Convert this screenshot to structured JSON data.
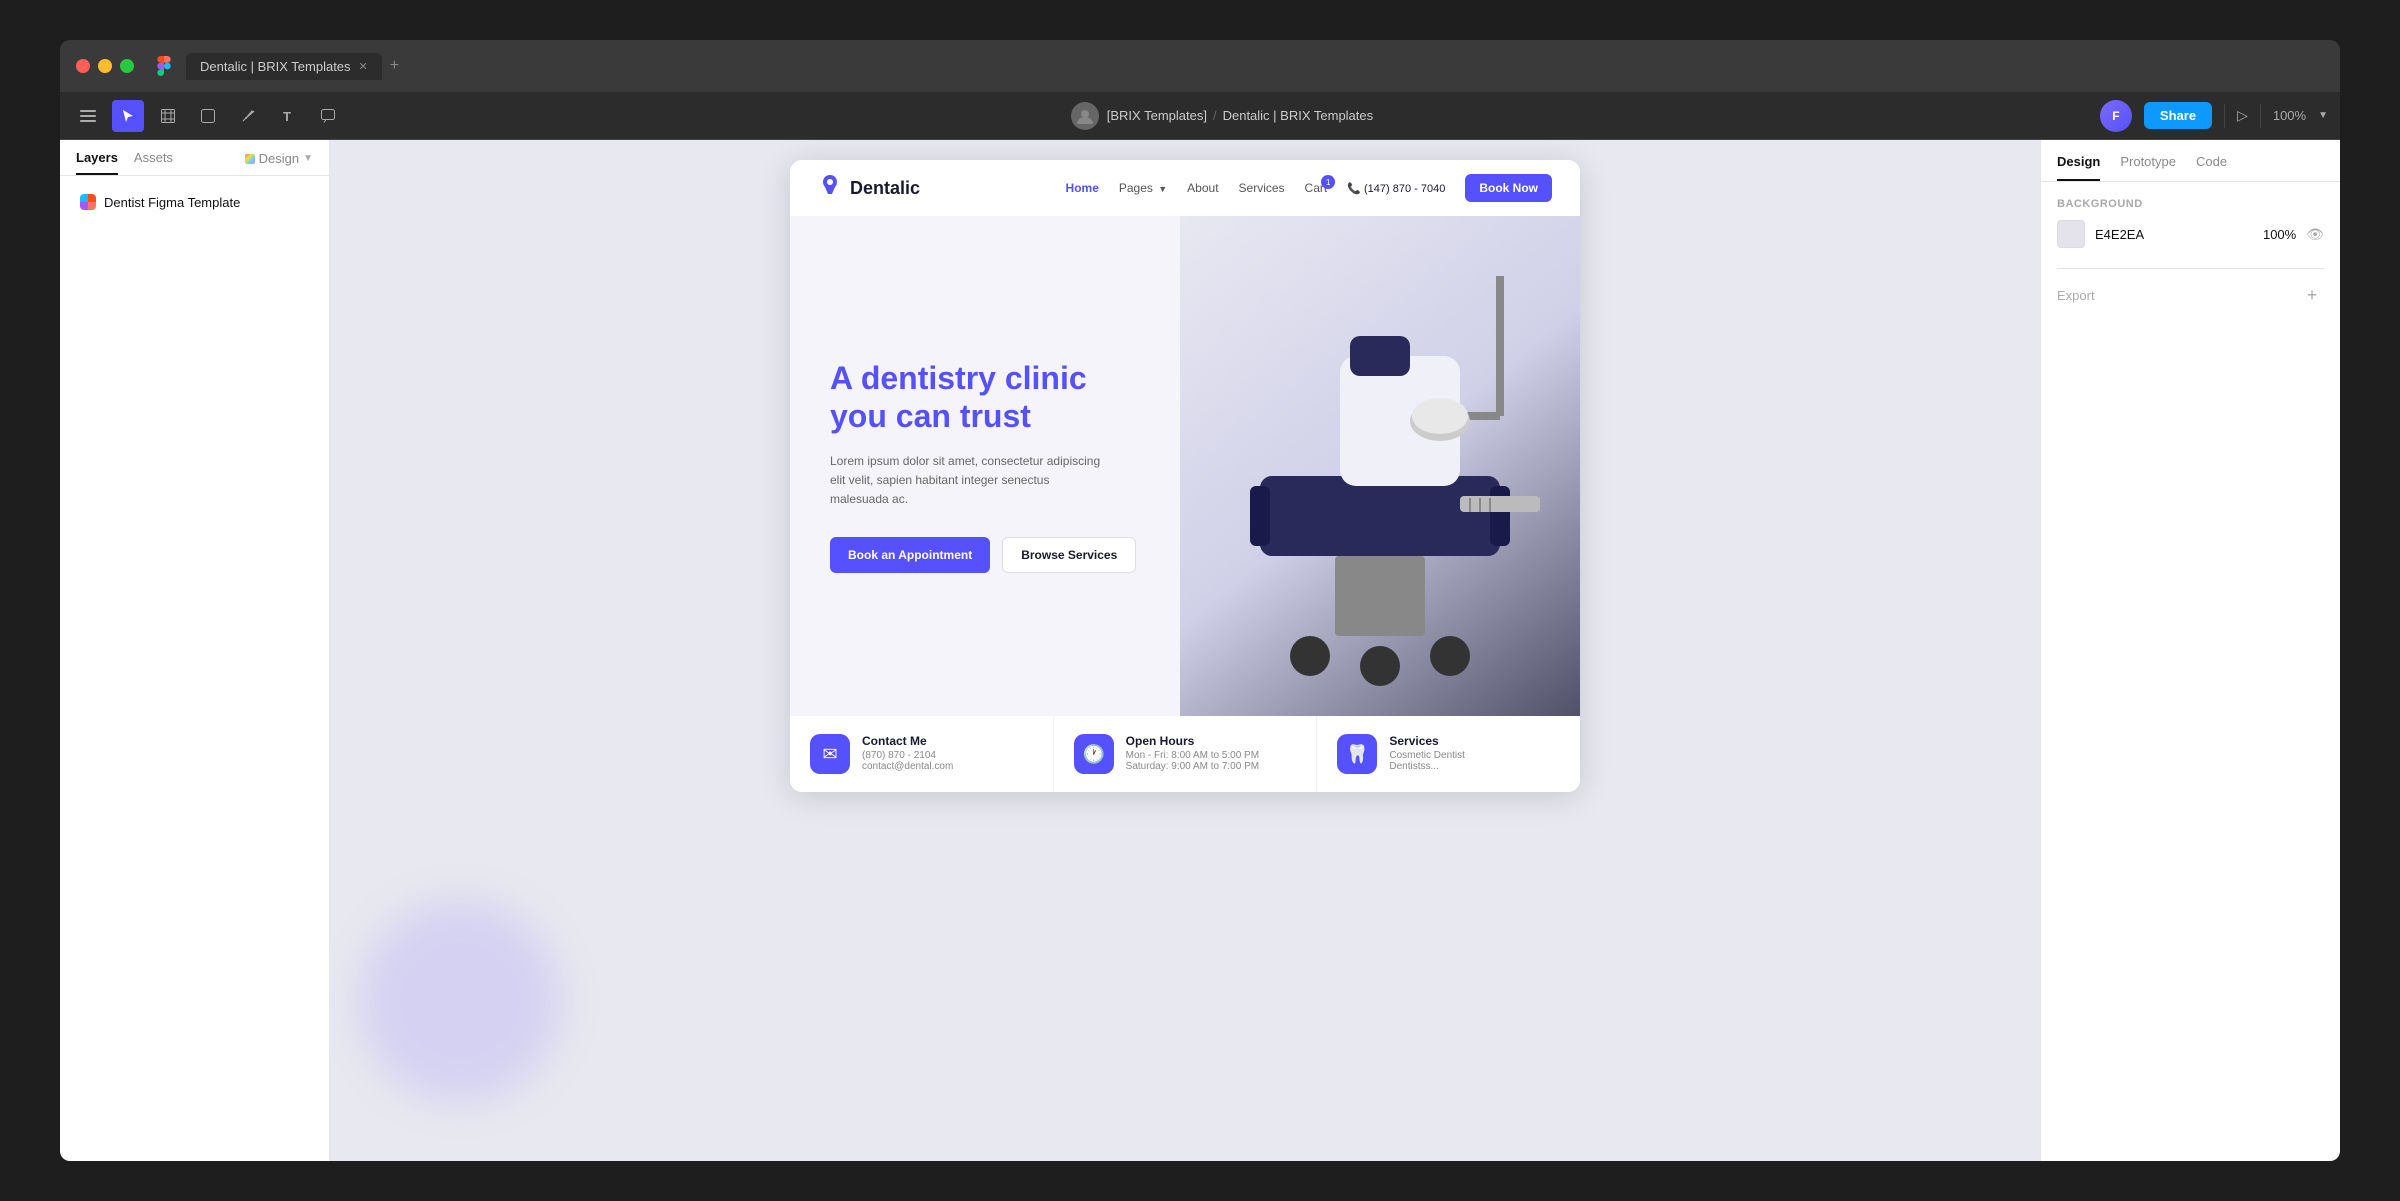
{
  "window": {
    "title": "Dentalic | BRIX Templates",
    "tab_label": "Dentalic | BRIX Templates"
  },
  "toolbar": {
    "breadcrumb_team": "[BRIX Templates]",
    "breadcrumb_file": "Dentalic | BRIX Templates",
    "share_label": "Share",
    "zoom": "100%"
  },
  "left_panel": {
    "tab_layers": "Layers",
    "tab_assets": "Assets",
    "tab_design": "Design",
    "layer_item": "Dentist Figma Template"
  },
  "right_panel": {
    "tab_design": "Design",
    "tab_prototype": "Prototype",
    "tab_code": "Code",
    "background_label": "Background",
    "bg_hex": "E4E2EA",
    "bg_opacity": "100%",
    "export_label": "Export"
  },
  "website": {
    "brand_name": "Dentalic",
    "nav_home": "Home",
    "nav_pages": "Pages",
    "nav_about": "About",
    "nav_services": "Services",
    "nav_cart": "Cart",
    "nav_cart_count": "1",
    "nav_phone": "(147) 870 - 7040",
    "nav_book": "Book Now",
    "hero_title_prefix": "A",
    "hero_title_highlight": "dentistry clinic",
    "hero_title_suffix": "you can trust",
    "hero_subtitle": "Lorem ipsum dolor sit amet, consectetur adipiscing elit velit, sapien habitant integer senectus malesuada ac.",
    "btn_book": "Book an Appointment",
    "btn_browse": "Browse Services",
    "info_card1_title": "Contact Me",
    "info_card1_line1": "(870) 870 - 2104",
    "info_card1_line2": "contact@dental.com",
    "info_card2_title": "Open Hours",
    "info_card2_line1": "Mon - Fri: 8:00 AM to 5:00 PM",
    "info_card2_line2": "Saturday: 9:00 AM to 7:00 PM",
    "info_card3_title": "Services",
    "info_card3_line1": "Cosmetic Dentist",
    "info_card3_line2": "Dentistss..."
  }
}
